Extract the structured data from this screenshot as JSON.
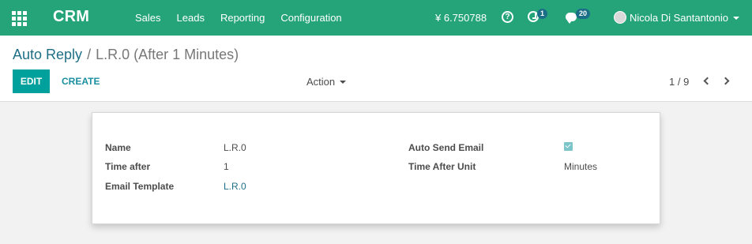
{
  "navbar": {
    "brand": "CRM",
    "menu": [
      "Sales",
      "Leads",
      "Reporting",
      "Configuration"
    ],
    "currency": "¥ 6.750788",
    "activity_count": "1",
    "message_count": "20",
    "user_name": "Nicola Di Santantonio",
    "colors": {
      "bar": "#25a47a",
      "badge": "#1a6e88"
    }
  },
  "breadcrumb": {
    "parent": "Auto Reply",
    "separator": "/",
    "current": "L.R.0 (After 1 Minutes)"
  },
  "toolbar": {
    "edit_label": "EDIT",
    "create_label": "CREATE",
    "action_label": "Action",
    "pager": "1 / 9"
  },
  "form": {
    "left": [
      {
        "label": "Name",
        "value": "L.R.0"
      },
      {
        "label": "Time after",
        "value": "1"
      },
      {
        "label": "Email Template",
        "value": "L.R.0"
      }
    ],
    "right": [
      {
        "label": "Auto Send Email",
        "checked": true
      },
      {
        "label": "Time After Unit",
        "value": "Minutes"
      }
    ]
  }
}
